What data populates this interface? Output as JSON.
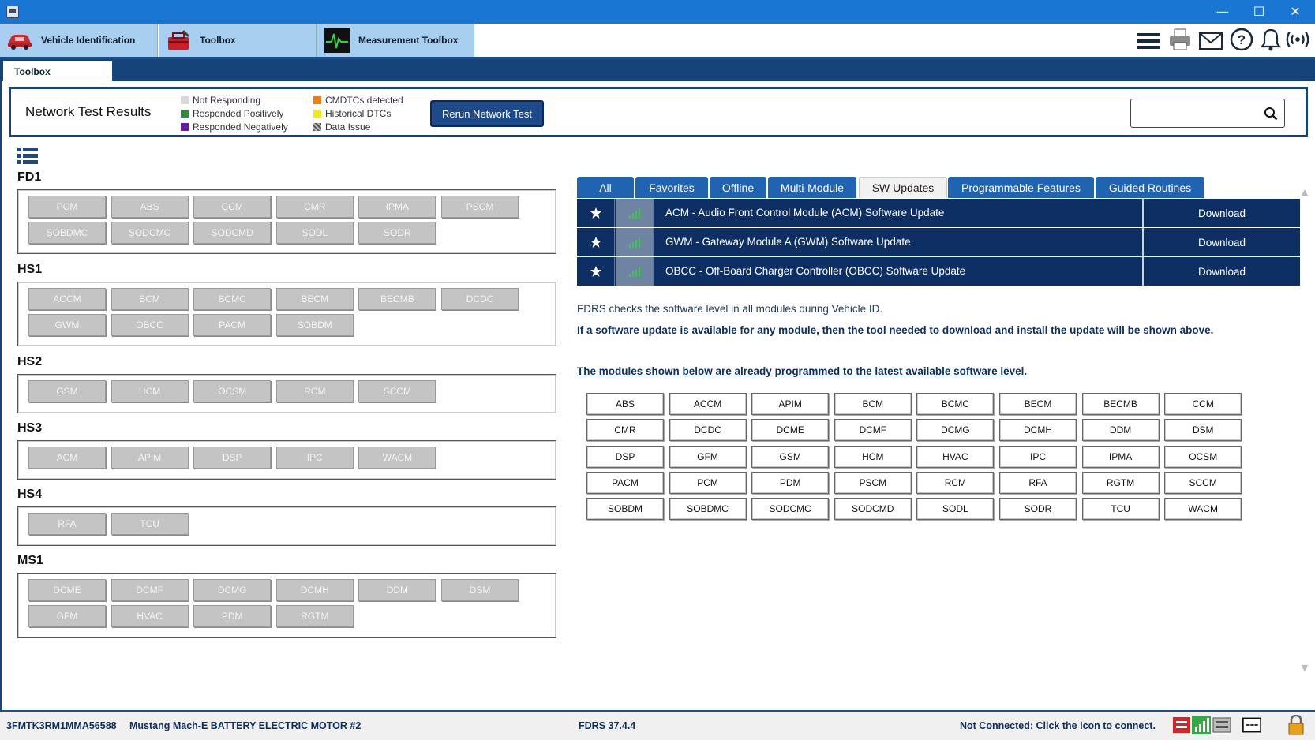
{
  "window": {
    "minimize": "—",
    "maximize": "☐",
    "close": "✕"
  },
  "toolbar": {
    "tabs": [
      {
        "label": "Vehicle Identification",
        "icon": "car-icon"
      },
      {
        "label": "Toolbox",
        "icon": "toolbox-icon"
      },
      {
        "label": "Measurement Toolbox",
        "icon": "oscilloscope-icon"
      }
    ],
    "icons": [
      "menu-icon",
      "printer-icon",
      "mail-icon",
      "help-icon",
      "bell-icon",
      "wireless-icon"
    ]
  },
  "subtab": {
    "label": "Toolbox"
  },
  "network": {
    "title": "Network Test Results",
    "legend": [
      {
        "label": "Not Responding",
        "color": "#d8d8d8"
      },
      {
        "label": "Responded Positively",
        "color": "#2e8b3a"
      },
      {
        "label": "Responded Negatively",
        "color": "#6a1aa8"
      },
      {
        "label": "CMDTCs detected",
        "color": "#f07c14"
      },
      {
        "label": "Historical DTCs",
        "color": "#f4e81a"
      },
      {
        "label": "Data Issue",
        "color": "#777777"
      }
    ],
    "rerun_label": "Rerun Network Test",
    "search_value": ""
  },
  "groups": [
    {
      "name": "FD1",
      "modules": [
        "PCM",
        "ABS",
        "CCM",
        "CMR",
        "IPMA",
        "PSCM",
        "SOBDMC",
        "SODCMC",
        "SODCMD",
        "SODL",
        "SODR"
      ]
    },
    {
      "name": "HS1",
      "modules": [
        "ACCM",
        "BCM",
        "BCMC",
        "BECM",
        "BECMB",
        "DCDC",
        "GWM",
        "OBCC",
        "PACM",
        "SOBDM"
      ]
    },
    {
      "name": "HS2",
      "modules": [
        "GSM",
        "HCM",
        "OCSM",
        "RCM",
        "SCCM"
      ]
    },
    {
      "name": "HS3",
      "modules": [
        "ACM",
        "APIM",
        "DSP",
        "IPC",
        "WACM"
      ]
    },
    {
      "name": "HS4",
      "modules": [
        "RFA",
        "TCU"
      ]
    },
    {
      "name": "MS1",
      "modules": [
        "DCME",
        "DCMF",
        "DCMG",
        "DCMH",
        "DDM",
        "DSM",
        "GFM",
        "HVAC",
        "PDM",
        "RGTM"
      ]
    }
  ],
  "right_tabs": [
    "All",
    "Favorites",
    "Offline",
    "Multi-Module",
    "SW Updates",
    "Programmable Features",
    "Guided Routines"
  ],
  "active_tab": "SW Updates",
  "updates": [
    {
      "name": "ACM - Audio Front Control Module (ACM) Software Update",
      "action": "Download"
    },
    {
      "name": "GWM - Gateway Module A (GWM) Software Update",
      "action": "Download"
    },
    {
      "name": "OBCC - Off-Board Charger Controller (OBCC) Software Update",
      "action": "Download"
    }
  ],
  "info": {
    "line1": "FDRS checks the software level in all modules during Vehicle ID.",
    "line2": "If a software update is available for any module, then the tool needed to download and install the update will be shown above.",
    "line3": "The modules shown below are already programmed to the latest available software level."
  },
  "latest_modules": [
    "ABS",
    "ACCM",
    "APIM",
    "BCM",
    "BCMC",
    "BECM",
    "BECMB",
    "CCM",
    "CMR",
    "DCDC",
    "DCME",
    "DCMF",
    "DCMG",
    "DCMH",
    "DDM",
    "DSM",
    "DSP",
    "GFM",
    "GSM",
    "HCM",
    "HVAC",
    "IPC",
    "IPMA",
    "OCSM",
    "PACM",
    "PCM",
    "PDM",
    "PSCM",
    "RCM",
    "RFA",
    "RGTM",
    "SCCM",
    "SOBDM",
    "SOBDMC",
    "SODCMC",
    "SODCMD",
    "SODL",
    "SODR",
    "TCU",
    "WACM"
  ],
  "status": {
    "vin": "3FMTK3RM1MMA56588",
    "vehicle": "Mustang Mach-E BATTERY ELECTRIC MOTOR #2",
    "version": "FDRS 37.4.4",
    "connection": "Not Connected: Click the icon to connect."
  }
}
